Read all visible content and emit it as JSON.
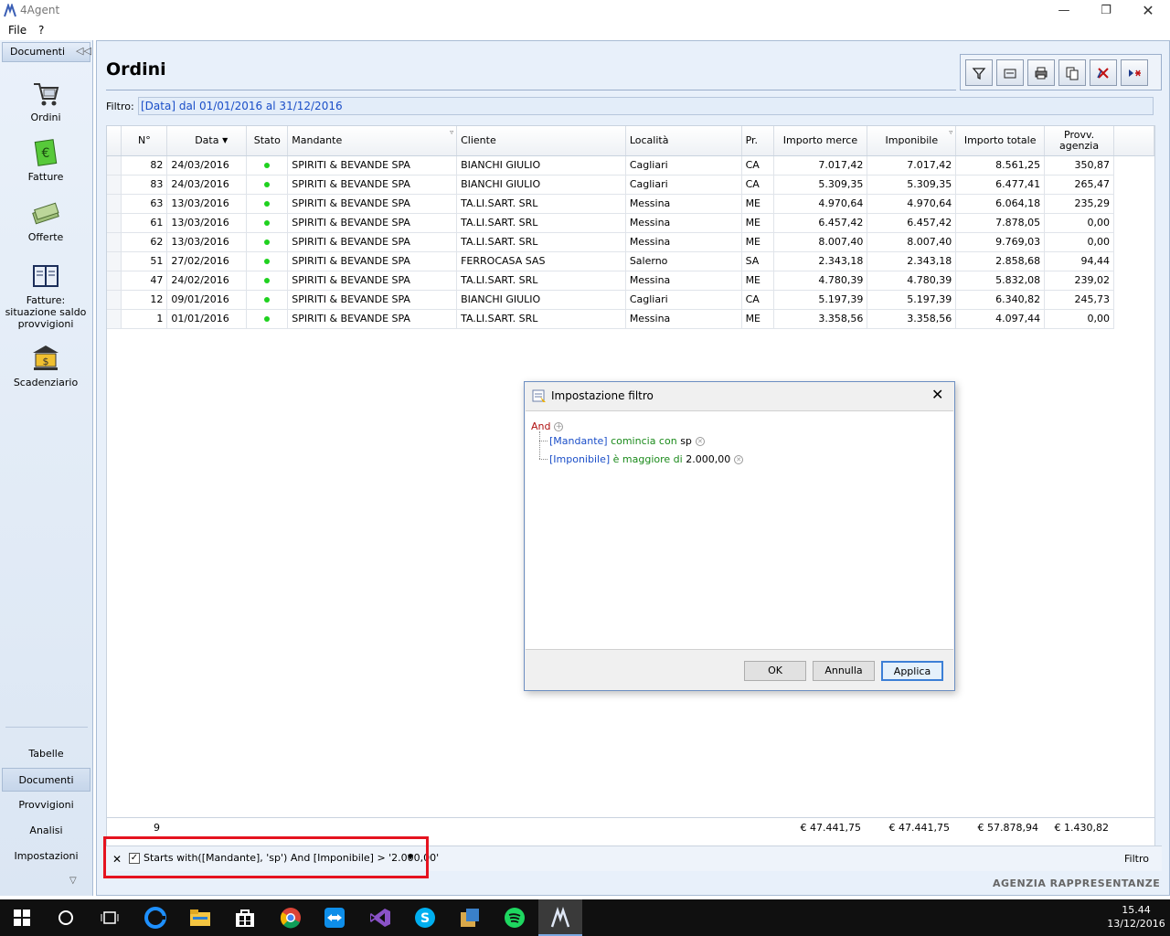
{
  "window": {
    "title": "4Agent"
  },
  "menu": {
    "file": "File",
    "help": "?"
  },
  "nav": {
    "header": "Documenti",
    "big_items": [
      {
        "label": "Ordini"
      },
      {
        "label": "Fatture"
      },
      {
        "label": "Offerte"
      },
      {
        "label": "Fatture: situazione saldo provvigioni"
      },
      {
        "label": "Scadenziario"
      }
    ],
    "small_items": [
      "Tabelle",
      "Documenti",
      "Provvigioni",
      "Analisi",
      "Impostazioni"
    ]
  },
  "page": {
    "title": "Ordini",
    "filter_label": "Filtro:",
    "filter_text": "[Data] dal 01/01/2016 al 31/12/2016"
  },
  "grid": {
    "columns": [
      "N°",
      "Data",
      "Stato",
      "Mandante",
      "Cliente",
      "Località",
      "Pr.",
      "Importo merce",
      "Imponibile",
      "Importo totale",
      "Provv. agenzia"
    ],
    "rows": [
      {
        "n": "82",
        "data": "24/03/2016",
        "mandante": "SPIRITI & BEVANDE SPA",
        "cliente": "BIANCHI GIULIO",
        "localita": "Cagliari",
        "pr": "CA",
        "merce": "7.017,42",
        "imponibile": "7.017,42",
        "totale": "8.561,25",
        "provv": "350,87"
      },
      {
        "n": "83",
        "data": "24/03/2016",
        "mandante": "SPIRITI & BEVANDE SPA",
        "cliente": "BIANCHI GIULIO",
        "localita": "Cagliari",
        "pr": "CA",
        "merce": "5.309,35",
        "imponibile": "5.309,35",
        "totale": "6.477,41",
        "provv": "265,47"
      },
      {
        "n": "63",
        "data": "13/03/2016",
        "mandante": "SPIRITI & BEVANDE SPA",
        "cliente": "TA.LI.SART. SRL",
        "localita": "Messina",
        "pr": "ME",
        "merce": "4.970,64",
        "imponibile": "4.970,64",
        "totale": "6.064,18",
        "provv": "235,29"
      },
      {
        "n": "61",
        "data": "13/03/2016",
        "mandante": "SPIRITI & BEVANDE SPA",
        "cliente": "TA.LI.SART. SRL",
        "localita": "Messina",
        "pr": "ME",
        "merce": "6.457,42",
        "imponibile": "6.457,42",
        "totale": "7.878,05",
        "provv": "0,00"
      },
      {
        "n": "62",
        "data": "13/03/2016",
        "mandante": "SPIRITI & BEVANDE SPA",
        "cliente": "TA.LI.SART. SRL",
        "localita": "Messina",
        "pr": "ME",
        "merce": "8.007,40",
        "imponibile": "8.007,40",
        "totale": "9.769,03",
        "provv": "0,00"
      },
      {
        "n": "51",
        "data": "27/02/2016",
        "mandante": "SPIRITI & BEVANDE SPA",
        "cliente": "FERROCASA SAS",
        "localita": "Salerno",
        "pr": "SA",
        "merce": "2.343,18",
        "imponibile": "2.343,18",
        "totale": "2.858,68",
        "provv": "94,44"
      },
      {
        "n": "47",
        "data": "24/02/2016",
        "mandante": "SPIRITI & BEVANDE SPA",
        "cliente": "TA.LI.SART. SRL",
        "localita": "Messina",
        "pr": "ME",
        "merce": "4.780,39",
        "imponibile": "4.780,39",
        "totale": "5.832,08",
        "provv": "239,02"
      },
      {
        "n": "12",
        "data": "09/01/2016",
        "mandante": "SPIRITI & BEVANDE SPA",
        "cliente": "BIANCHI GIULIO",
        "localita": "Cagliari",
        "pr": "CA",
        "merce": "5.197,39",
        "imponibile": "5.197,39",
        "totale": "6.340,82",
        "provv": "245,73"
      },
      {
        "n": "1",
        "data": "01/01/2016",
        "mandante": "SPIRITI & BEVANDE SPA",
        "cliente": "TA.LI.SART. SRL",
        "localita": "Messina",
        "pr": "ME",
        "merce": "3.358,56",
        "imponibile": "3.358,56",
        "totale": "4.097,44",
        "provv": "0,00"
      }
    ],
    "footer": {
      "count": "9",
      "merce": "€ 47.441,75",
      "imponibile": "€ 47.441,75",
      "totale": "€ 57.878,94",
      "provv": "€ 1.430,82"
    }
  },
  "filterbar": {
    "expression": "Starts with([Mandante], 'sp') And [Imponibile] > '2.000,00'",
    "edit_label": "Filtro"
  },
  "brand": "AGENZIA RAPPRESENTANZE",
  "dialog": {
    "title": "Impostazione filtro",
    "root_op": "And",
    "conditions": [
      {
        "field": "[Mandante]",
        "op": "comincia con",
        "value": "sp"
      },
      {
        "field": "[Imponibile]",
        "op": "è maggiore di",
        "value": "2.000,00"
      }
    ],
    "ok": "OK",
    "cancel": "Annulla",
    "apply": "Applica"
  },
  "clock": {
    "time": "15.44",
    "date": "13/12/2016"
  },
  "colors": {
    "accent": "#1a4ec8",
    "highlight": "#e5131f",
    "status_ok": "#1fd11f"
  }
}
